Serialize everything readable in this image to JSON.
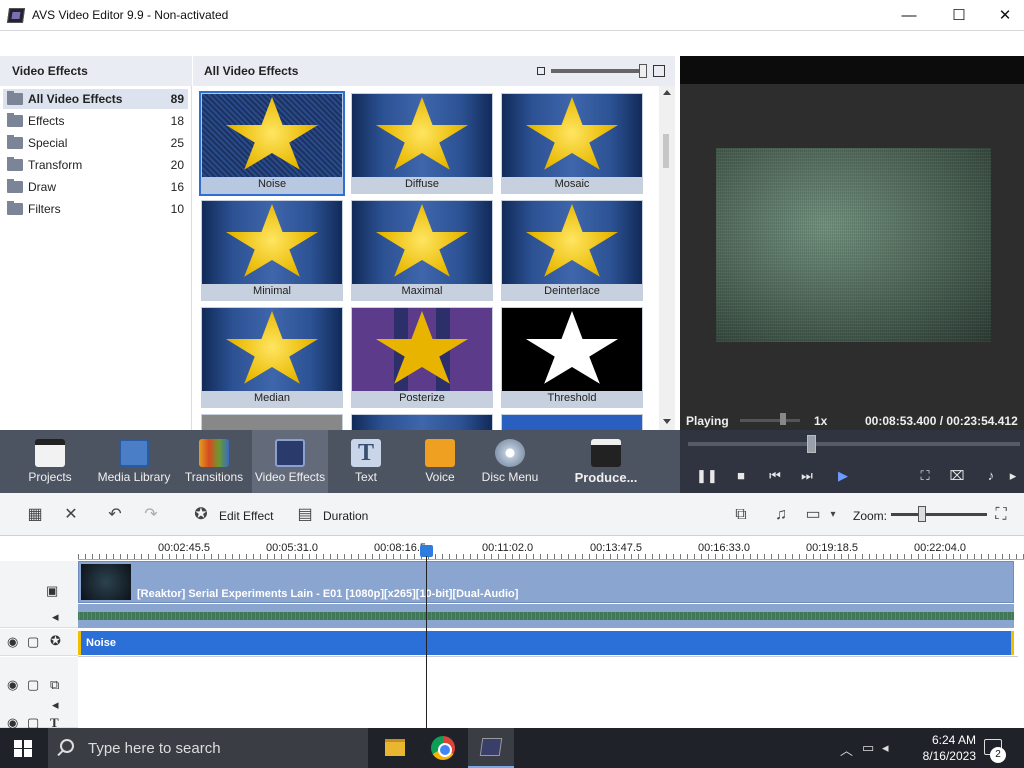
{
  "window": {
    "title": "AVS Video Editor 9.9 - Non-activated",
    "minimize": "—",
    "maximize": "☐",
    "close": "✕"
  },
  "left_panel": {
    "title": "Video Effects",
    "items": [
      {
        "label": "All Video Effects",
        "count": "89"
      },
      {
        "label": "Effects",
        "count": "18"
      },
      {
        "label": "Special",
        "count": "25"
      },
      {
        "label": "Transform",
        "count": "20"
      },
      {
        "label": "Draw",
        "count": "16"
      },
      {
        "label": "Filters",
        "count": "10"
      }
    ]
  },
  "effects_panel": {
    "title": "All Video Effects",
    "tiles": [
      "Noise",
      "Diffuse",
      "Mosaic",
      "Minimal",
      "Maximal",
      "Deinterlace",
      "Median",
      "Posterize",
      "Threshold"
    ]
  },
  "preview": {
    "status": "Playing",
    "speed": "1x",
    "time": "00:08:53.400 / 00:23:54.412"
  },
  "toolbar": {
    "projects": "Projects",
    "media_library": "Media Library",
    "transitions": "Transitions",
    "video_effects": "Video Effects",
    "text": "Text",
    "voice": "Voice",
    "disc_menu": "Disc Menu",
    "produce": "Produce..."
  },
  "timeline_toolbar": {
    "edit_effect": "Edit Effect",
    "duration": "Duration",
    "zoom": "Zoom:"
  },
  "ruler": [
    "00:02:45.5",
    "00:05:31.0",
    "00:08:16.5",
    "00:11:02.0",
    "00:13:47.5",
    "00:16:33.0",
    "00:19:18.5",
    "00:22:04.0"
  ],
  "tracks": {
    "video_clip": "[Reaktor] Serial Experiments Lain - E01 [1080p][x265][10-bit][Dual-Audio]",
    "effect_clip": "Noise"
  },
  "taskbar": {
    "search_placeholder": "Type here to search",
    "time": "6:24 AM",
    "date": "8/16/2023",
    "notifications": "2"
  },
  "colors": {
    "accent": "#2b6fd8",
    "toolbar": "#4c5361",
    "effect_border": "#f0c000"
  }
}
